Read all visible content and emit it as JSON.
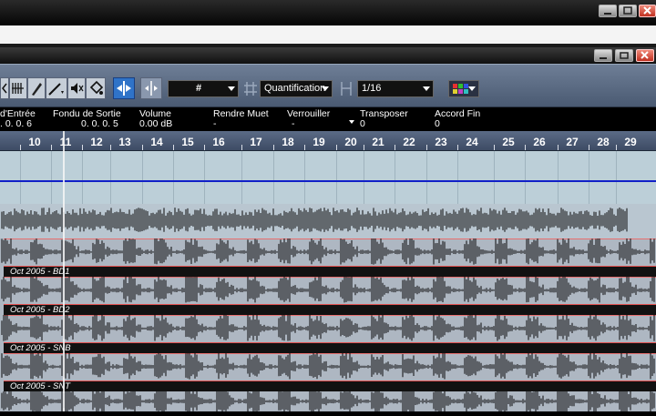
{
  "window": {
    "outer_controls": [
      "minimize-icon",
      "maximize-icon",
      "close-icon"
    ],
    "inner_controls": [
      "minimize-icon",
      "restore-icon",
      "close-icon"
    ]
  },
  "toolbar": {
    "snap_grid_symbol": "#",
    "quantize_label": "Quantification",
    "quantize_value": "1/16",
    "colors": {
      "active_button": "#2f73c8",
      "toolbar_bg": "#5a6a84"
    }
  },
  "infoline": {
    "fade_in_label": "d'Entrée",
    "fade_in_value": ". 0. 0. 6",
    "fade_out_label": "Fondu de Sortie",
    "fade_out_value": "0. 0. 0. 5",
    "volume_label": "Volume",
    "volume_value": "0.00 dB",
    "mute_label": "Rendre Muet",
    "mute_value": "-",
    "lock_label": "Verrouiller",
    "lock_value": "-",
    "transpose_label": "Transposer",
    "transpose_value": "0",
    "finetune_label": "Accord Fin",
    "finetune_value": "0"
  },
  "ruler": {
    "bars": [
      "10",
      "11",
      "12",
      "13",
      "14",
      "15",
      "16",
      "17",
      "18",
      "19",
      "20",
      "21",
      "22",
      "23",
      "24",
      "25",
      "26",
      "27",
      "28",
      "29"
    ]
  },
  "tracks": [
    {
      "name": "Oct 2005 - BD1"
    },
    {
      "name": "Oct 2005 - BD2"
    },
    {
      "name": "Oct 2005 - SNB"
    },
    {
      "name": "Oct 2005 - SNT"
    }
  ]
}
